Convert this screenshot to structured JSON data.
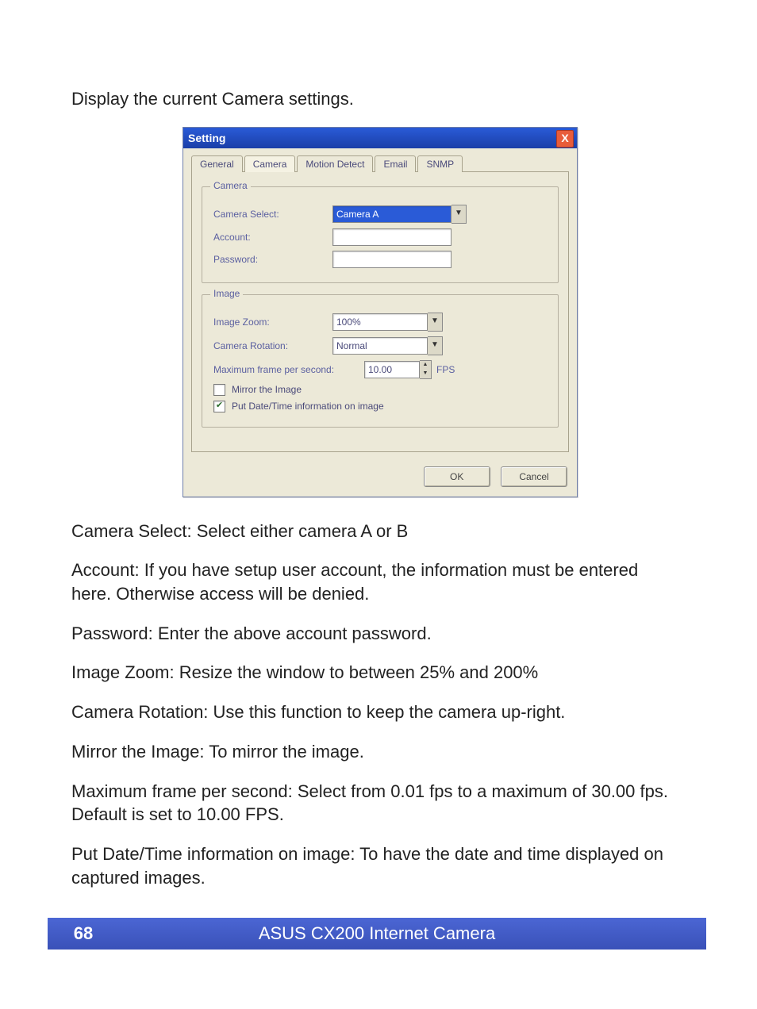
{
  "intro": "Display the current Camera settings.",
  "dialog": {
    "title": "Setting",
    "close": "X",
    "tabs": {
      "general": "General",
      "camera": "Camera",
      "motion": "Motion Detect",
      "email": "Email",
      "snmp": "SNMP"
    },
    "camera_group": {
      "title": "Camera",
      "camera_select_label": "Camera Select:",
      "camera_select_value": "Camera A",
      "account_label": "Account:",
      "account_value": "",
      "password_label": "Password:",
      "password_value": ""
    },
    "image_group": {
      "title": "Image",
      "zoom_label": "Image Zoom:",
      "zoom_value": "100%",
      "rotation_label": "Camera Rotation:",
      "rotation_value": "Normal",
      "fps_label": "Maximum frame per second:",
      "fps_value": "10.00",
      "fps_unit": "FPS",
      "mirror_label": "Mirror the Image",
      "datetime_label": "Put Date/Time information on image"
    },
    "ok": "OK",
    "cancel": "Cancel"
  },
  "descriptions": {
    "camera_select": "Camera Select: Select either camera A or B",
    "account": "Account: If you have setup user account, the information must be entered here.  Otherwise access will be denied.",
    "password": "Password: Enter the above account password.",
    "zoom": "Image Zoom: Resize the window to between 25% and 200%",
    "rotation": "Camera Rotation: Use this function to keep the camera up-right.",
    "mirror": "Mirror the Image: To mirror the image.",
    "fps": "Maximum frame per second: Select from 0.01 fps to a maximum of 30.00 fps. Default is set to 10.00 FPS.",
    "datetime": "Put Date/Time information on image: To have the date and time displayed on captured images."
  },
  "footer": {
    "page": "68",
    "title": "ASUS CX200 Internet Camera"
  }
}
